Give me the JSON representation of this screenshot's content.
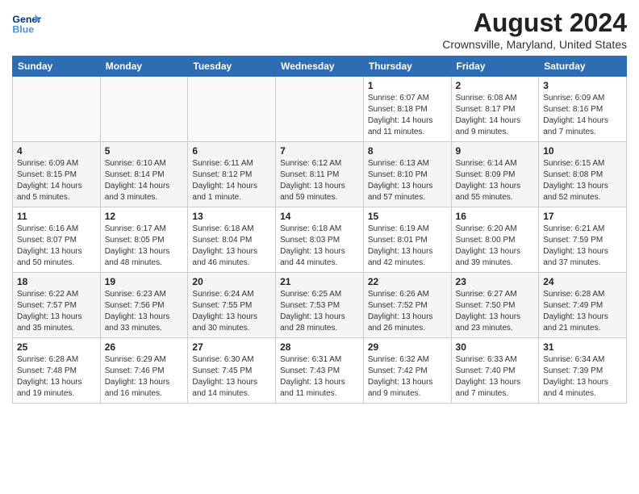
{
  "header": {
    "logo_line1": "General",
    "logo_line2": "Blue",
    "month_year": "August 2024",
    "location": "Crownsville, Maryland, United States"
  },
  "days_of_week": [
    "Sunday",
    "Monday",
    "Tuesday",
    "Wednesday",
    "Thursday",
    "Friday",
    "Saturday"
  ],
  "weeks": [
    [
      {
        "day": "",
        "info": ""
      },
      {
        "day": "",
        "info": ""
      },
      {
        "day": "",
        "info": ""
      },
      {
        "day": "",
        "info": ""
      },
      {
        "day": "1",
        "info": "Sunrise: 6:07 AM\nSunset: 8:18 PM\nDaylight: 14 hours\nand 11 minutes."
      },
      {
        "day": "2",
        "info": "Sunrise: 6:08 AM\nSunset: 8:17 PM\nDaylight: 14 hours\nand 9 minutes."
      },
      {
        "day": "3",
        "info": "Sunrise: 6:09 AM\nSunset: 8:16 PM\nDaylight: 14 hours\nand 7 minutes."
      }
    ],
    [
      {
        "day": "4",
        "info": "Sunrise: 6:09 AM\nSunset: 8:15 PM\nDaylight: 14 hours\nand 5 minutes."
      },
      {
        "day": "5",
        "info": "Sunrise: 6:10 AM\nSunset: 8:14 PM\nDaylight: 14 hours\nand 3 minutes."
      },
      {
        "day": "6",
        "info": "Sunrise: 6:11 AM\nSunset: 8:12 PM\nDaylight: 14 hours\nand 1 minute."
      },
      {
        "day": "7",
        "info": "Sunrise: 6:12 AM\nSunset: 8:11 PM\nDaylight: 13 hours\nand 59 minutes."
      },
      {
        "day": "8",
        "info": "Sunrise: 6:13 AM\nSunset: 8:10 PM\nDaylight: 13 hours\nand 57 minutes."
      },
      {
        "day": "9",
        "info": "Sunrise: 6:14 AM\nSunset: 8:09 PM\nDaylight: 13 hours\nand 55 minutes."
      },
      {
        "day": "10",
        "info": "Sunrise: 6:15 AM\nSunset: 8:08 PM\nDaylight: 13 hours\nand 52 minutes."
      }
    ],
    [
      {
        "day": "11",
        "info": "Sunrise: 6:16 AM\nSunset: 8:07 PM\nDaylight: 13 hours\nand 50 minutes."
      },
      {
        "day": "12",
        "info": "Sunrise: 6:17 AM\nSunset: 8:05 PM\nDaylight: 13 hours\nand 48 minutes."
      },
      {
        "day": "13",
        "info": "Sunrise: 6:18 AM\nSunset: 8:04 PM\nDaylight: 13 hours\nand 46 minutes."
      },
      {
        "day": "14",
        "info": "Sunrise: 6:18 AM\nSunset: 8:03 PM\nDaylight: 13 hours\nand 44 minutes."
      },
      {
        "day": "15",
        "info": "Sunrise: 6:19 AM\nSunset: 8:01 PM\nDaylight: 13 hours\nand 42 minutes."
      },
      {
        "day": "16",
        "info": "Sunrise: 6:20 AM\nSunset: 8:00 PM\nDaylight: 13 hours\nand 39 minutes."
      },
      {
        "day": "17",
        "info": "Sunrise: 6:21 AM\nSunset: 7:59 PM\nDaylight: 13 hours\nand 37 minutes."
      }
    ],
    [
      {
        "day": "18",
        "info": "Sunrise: 6:22 AM\nSunset: 7:57 PM\nDaylight: 13 hours\nand 35 minutes."
      },
      {
        "day": "19",
        "info": "Sunrise: 6:23 AM\nSunset: 7:56 PM\nDaylight: 13 hours\nand 33 minutes."
      },
      {
        "day": "20",
        "info": "Sunrise: 6:24 AM\nSunset: 7:55 PM\nDaylight: 13 hours\nand 30 minutes."
      },
      {
        "day": "21",
        "info": "Sunrise: 6:25 AM\nSunset: 7:53 PM\nDaylight: 13 hours\nand 28 minutes."
      },
      {
        "day": "22",
        "info": "Sunrise: 6:26 AM\nSunset: 7:52 PM\nDaylight: 13 hours\nand 26 minutes."
      },
      {
        "day": "23",
        "info": "Sunrise: 6:27 AM\nSunset: 7:50 PM\nDaylight: 13 hours\nand 23 minutes."
      },
      {
        "day": "24",
        "info": "Sunrise: 6:28 AM\nSunset: 7:49 PM\nDaylight: 13 hours\nand 21 minutes."
      }
    ],
    [
      {
        "day": "25",
        "info": "Sunrise: 6:28 AM\nSunset: 7:48 PM\nDaylight: 13 hours\nand 19 minutes."
      },
      {
        "day": "26",
        "info": "Sunrise: 6:29 AM\nSunset: 7:46 PM\nDaylight: 13 hours\nand 16 minutes."
      },
      {
        "day": "27",
        "info": "Sunrise: 6:30 AM\nSunset: 7:45 PM\nDaylight: 13 hours\nand 14 minutes."
      },
      {
        "day": "28",
        "info": "Sunrise: 6:31 AM\nSunset: 7:43 PM\nDaylight: 13 hours\nand 11 minutes."
      },
      {
        "day": "29",
        "info": "Sunrise: 6:32 AM\nSunset: 7:42 PM\nDaylight: 13 hours\nand 9 minutes."
      },
      {
        "day": "30",
        "info": "Sunrise: 6:33 AM\nSunset: 7:40 PM\nDaylight: 13 hours\nand 7 minutes."
      },
      {
        "day": "31",
        "info": "Sunrise: 6:34 AM\nSunset: 7:39 PM\nDaylight: 13 hours\nand 4 minutes."
      }
    ]
  ]
}
